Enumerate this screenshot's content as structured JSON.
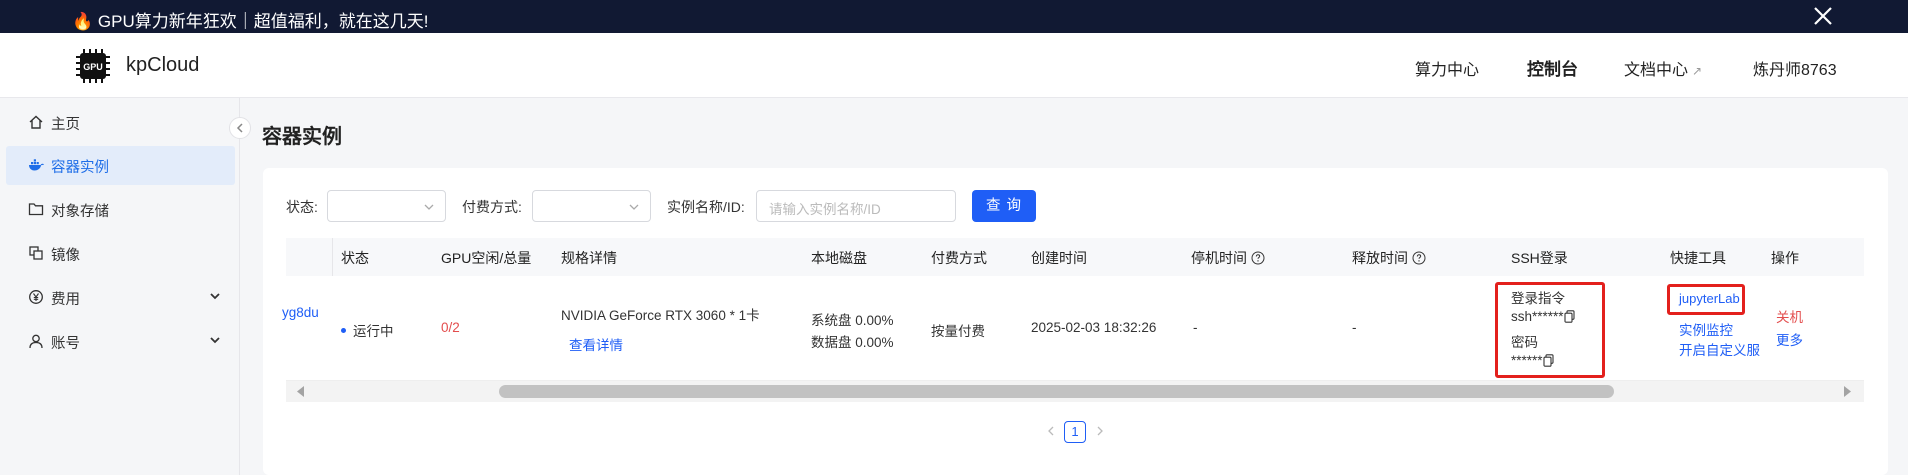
{
  "banner": {
    "text": "🔥 GPU算力新年狂欢｜超值福利，就在这几天!"
  },
  "header": {
    "brand": "kpCloud",
    "logo_text": "GPU",
    "nav": [
      "算力中心",
      "控制台",
      "文档中心",
      "炼丹师8763"
    ],
    "active_nav": "控制台",
    "doc_ext_icon": "↗"
  },
  "sidebar": {
    "items": [
      {
        "label": "主页",
        "icon": "home-icon"
      },
      {
        "label": "容器实例",
        "icon": "container-icon",
        "active": true
      },
      {
        "label": "对象存储",
        "icon": "folder-icon"
      },
      {
        "label": "镜像",
        "icon": "image-icon"
      },
      {
        "label": "费用",
        "icon": "yen-icon",
        "expandable": true
      },
      {
        "label": "账号",
        "icon": "user-icon",
        "expandable": true
      }
    ]
  },
  "page": {
    "title": "容器实例"
  },
  "filters": {
    "status_label": "状态:",
    "billing_label": "付费方式:",
    "name_label": "实例名称/ID:",
    "name_placeholder": "请输入实例名称/ID",
    "query_button": "查 询"
  },
  "table": {
    "columns": [
      "状态",
      "GPU空闲/总量",
      "规格详情",
      "本地磁盘",
      "付费方式",
      "创建时间",
      "停机时间",
      "释放时间",
      "SSH登录",
      "快捷工具",
      "操作"
    ],
    "rows": [
      {
        "id_partial": "yg8du",
        "status": "运行中",
        "gpu": "0/2",
        "spec": "NVIDIA GeForce RTX 3060 * 1卡",
        "spec_link": "查看详情",
        "disk_sys": "系统盘 0.00%",
        "disk_data": "数据盘 0.00%",
        "billing": "按量付费",
        "created": "2025-02-03 18:32:26",
        "stopped": "-",
        "released": "-",
        "ssh_cmd_label": "登录指令",
        "ssh_cmd": "ssh******",
        "ssh_pwd_label": "密码",
        "ssh_pwd": "******",
        "tools": [
          "jupyterLab",
          "实例监控",
          "开启自定义服"
        ],
        "ops": [
          "关机",
          "更多"
        ]
      }
    ]
  },
  "pagination": {
    "current": "1"
  },
  "colors": {
    "accent": "#1f5ef6",
    "danger": "#e34d4d",
    "highlight": "#e3201d",
    "banner_bg": "#111933"
  }
}
